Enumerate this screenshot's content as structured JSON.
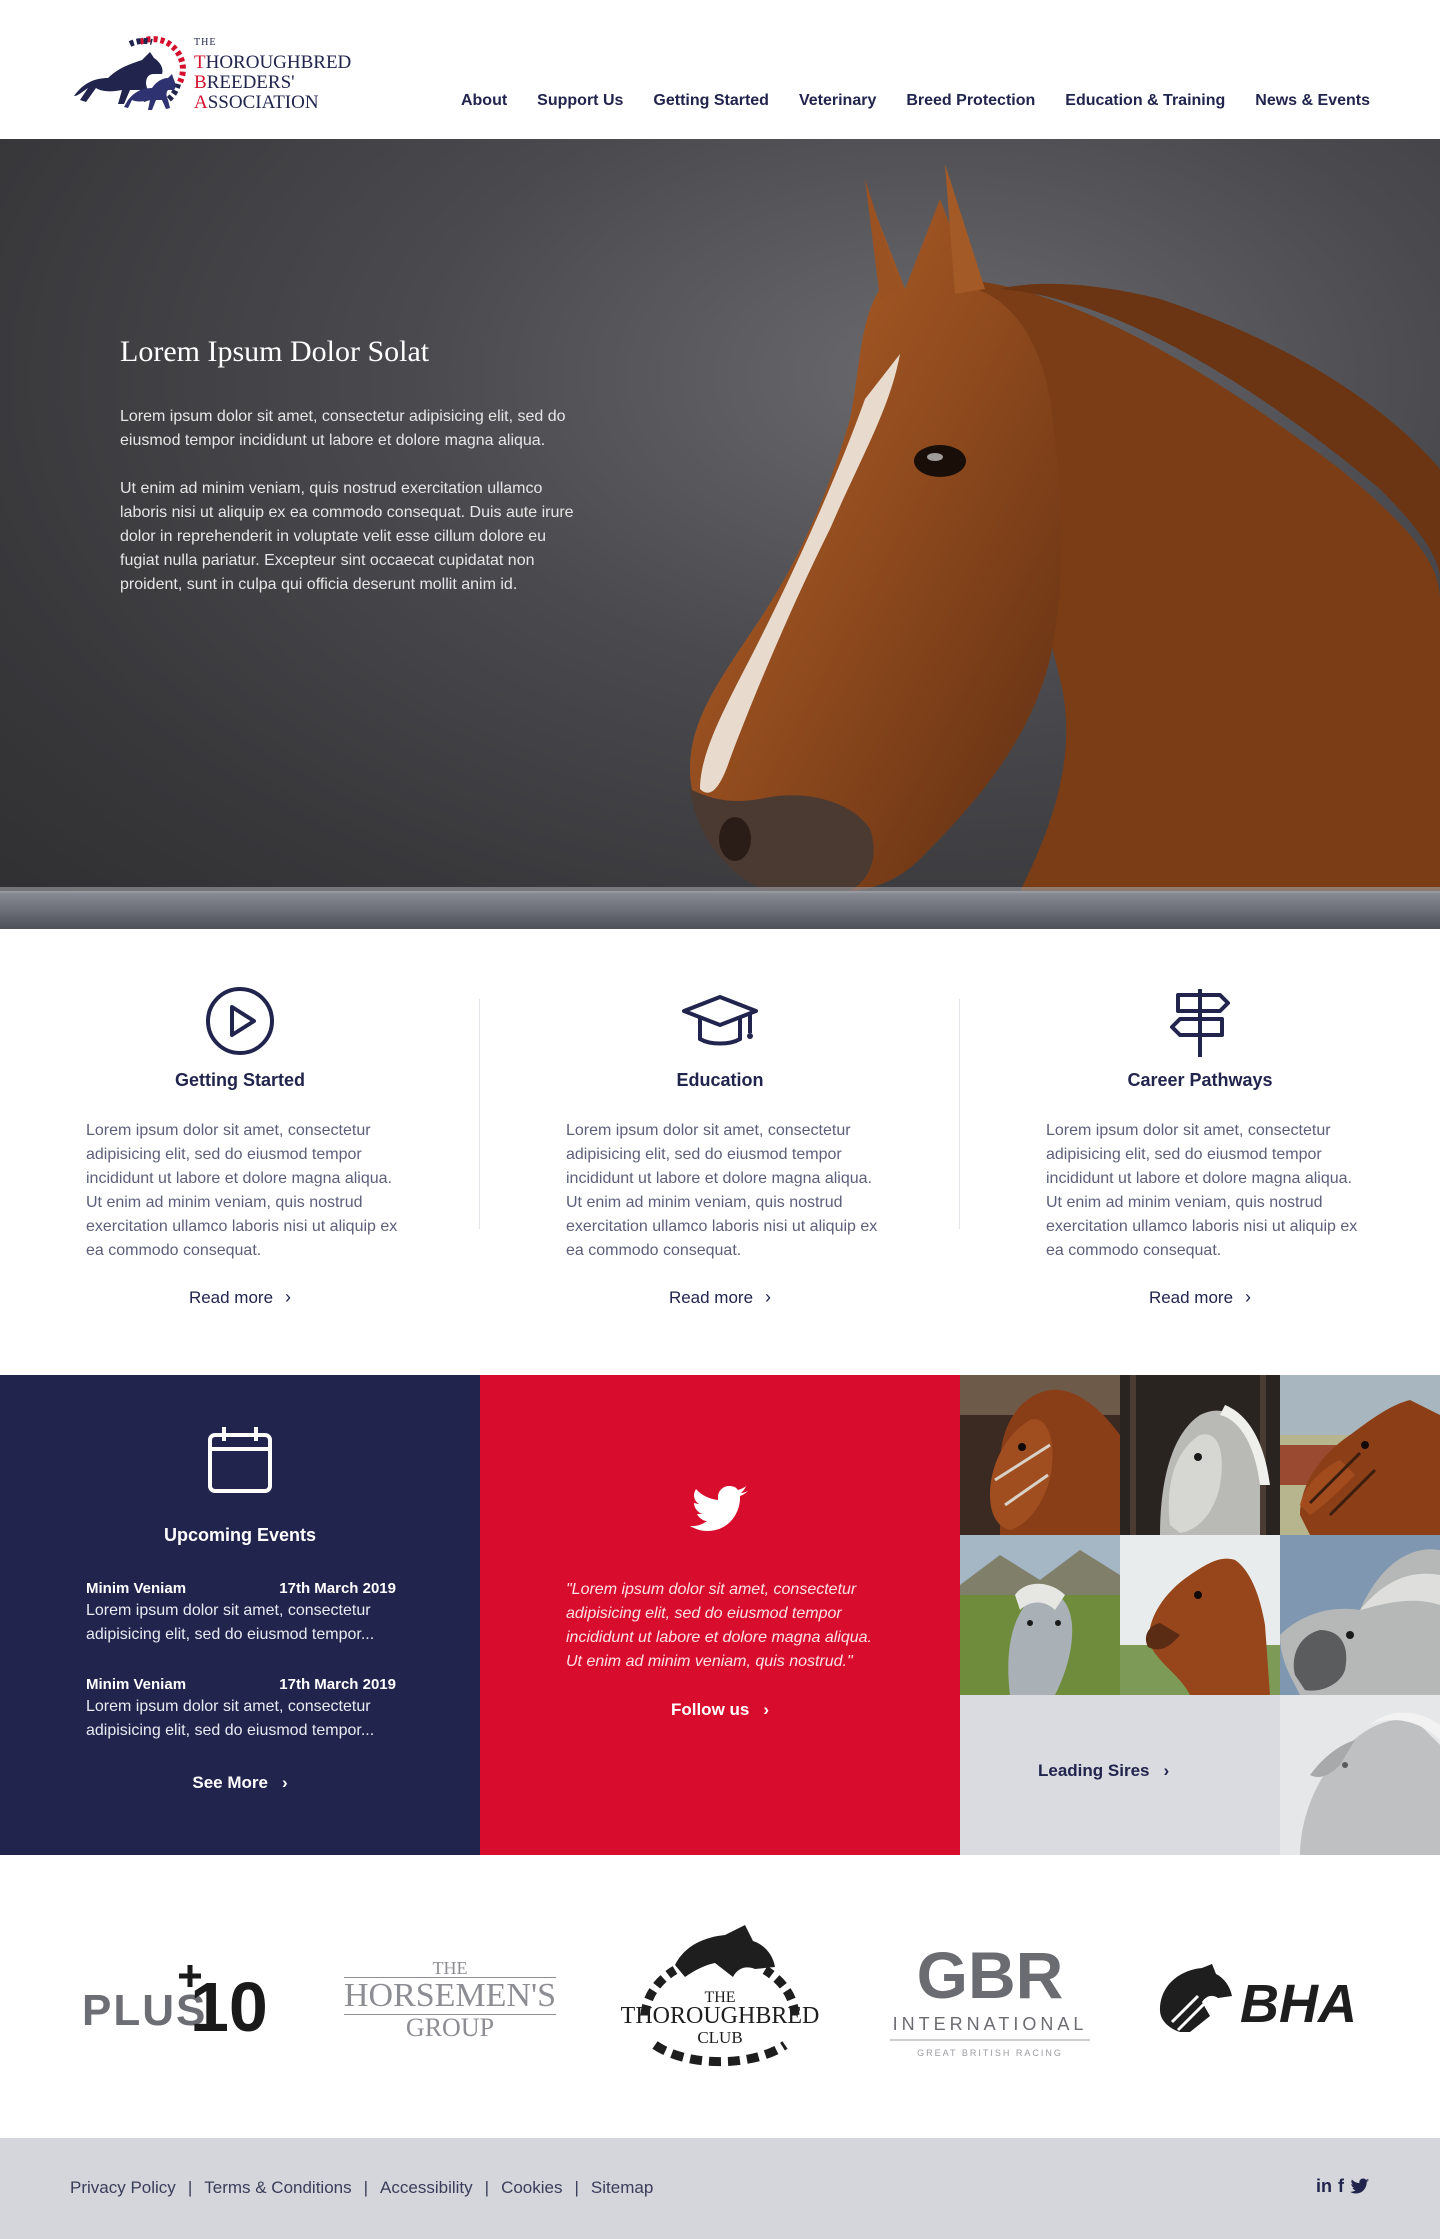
{
  "header": {
    "logo": {
      "the": "THE",
      "line1": "THOROUGHBRED",
      "line2": "BREEDERS'",
      "line3": "ASSOCIATION"
    },
    "nav": [
      "About",
      "Support Us",
      "Getting Started",
      "Veterinary",
      "Breed Protection",
      "Education & Training",
      "News & Events"
    ]
  },
  "hero": {
    "title": "Lorem Ipsum Dolor Solat",
    "paragraph1": "Lorem ipsum dolor sit amet, consectetur adipisicing elit, sed do eiusmod tempor incididunt ut labore et dolore magna aliqua.",
    "paragraph2": "Ut enim ad minim veniam, quis nostrud exercitation ullamco laboris nisi ut aliquip ex ea commodo consequat. Duis aute irure dolor in reprehenderit in voluptate velit esse cillum dolore eu fugiat nulla pariatur. Excepteur sint occaecat cupidatat non proident, sunt in culpa qui officia deserunt mollit anim id."
  },
  "features": [
    {
      "icon": "play-circle-icon",
      "title": "Getting Started",
      "text": "Lorem ipsum dolor sit amet, consectetur adipisicing elit, sed do eiusmod tempor incididunt ut labore et dolore magna aliqua. Ut enim ad minim veniam, quis nostrud exercitation ullamco laboris nisi ut aliquip ex ea commodo consequat.",
      "more": "Read more"
    },
    {
      "icon": "graduation-cap-icon",
      "title": "Education",
      "text": "Lorem ipsum dolor sit amet, consectetur adipisicing elit, sed do eiusmod tempor incididunt ut labore et dolore magna aliqua. Ut enim ad minim veniam, quis nostrud exercitation ullamco laboris nisi ut aliquip ex ea commodo consequat.",
      "more": "Read more"
    },
    {
      "icon": "signpost-icon",
      "title": "Career Pathways",
      "text": "Lorem ipsum dolor sit amet, consectetur adipisicing elit, sed do eiusmod tempor incididunt ut labore et dolore magna aliqua. Ut enim ad minim veniam, quis nostrud exercitation ullamco laboris nisi ut aliquip ex ea commodo consequat.",
      "more": "Read more"
    }
  ],
  "events": {
    "title": "Upcoming Events",
    "items": [
      {
        "name": "Minim Veniam",
        "date": "17th March 2019",
        "text": "Lorem ipsum dolor sit amet, consectetur adipisicing elit, sed do eiusmod tempor..."
      },
      {
        "name": "Minim Veniam",
        "date": "17th March 2019",
        "text": "Lorem ipsum dolor sit amet, consectetur adipisicing elit, sed do eiusmod tempor..."
      }
    ],
    "more": "See More"
  },
  "twitter": {
    "quote": "\"Lorem ipsum dolor sit amet, consectetur adipisicing elit, sed do eiusmod tempor incididunt ut labore et dolore magna aliqua. Ut enim ad minim veniam, quis nostrud.\"",
    "follow": "Follow us"
  },
  "sires": {
    "label": "Leading Sires"
  },
  "partners": {
    "plus10": {
      "plus": "PLUS",
      "ten": "10"
    },
    "horsemens": {
      "the": "THE",
      "name": "HORSEMEN'S",
      "group": "GROUP"
    },
    "tbclub": {
      "the": "THE",
      "name": "THOROUGHBRED",
      "club": "CLUB"
    },
    "gbr": {
      "gbr": "GBR",
      "intl": "INTERNATIONAL",
      "sub": "GREAT BRITISH RACING"
    },
    "bha": {
      "name": "BHA"
    }
  },
  "footer": {
    "links": [
      "Privacy Policy",
      "Terms & Conditions",
      "Accessibility",
      "Cookies",
      "Sitemap"
    ],
    "social": {
      "linkedin": "in",
      "facebook": "f"
    }
  },
  "colors": {
    "navy": "#21244d",
    "red": "#d80c2c",
    "grey": "#d4d6db"
  }
}
